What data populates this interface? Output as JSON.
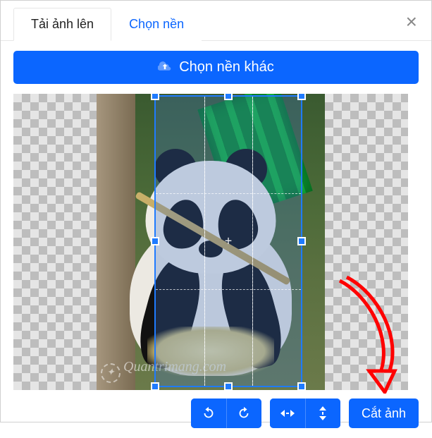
{
  "tabs": {
    "upload": "Tải ảnh lên",
    "choose_bg": "Chọn nền"
  },
  "buttons": {
    "choose_other_bg": "Chọn nền khác",
    "crop": "Cắt ảnh"
  },
  "toolbar": {
    "rotate_left": "rotate-left",
    "rotate_right": "rotate-right",
    "flip_h": "flip-horizontal",
    "flip_v": "flip-vertical"
  },
  "watermark": "Quantrimang.com",
  "colors": {
    "primary": "#0b66ff"
  }
}
